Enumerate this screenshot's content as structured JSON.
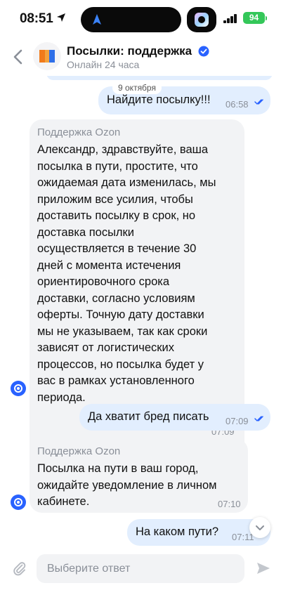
{
  "status_bar": {
    "time": "08:51",
    "battery": "94"
  },
  "header": {
    "title": "Посылки: поддержка",
    "subtitle": "Онлайн 24 часа"
  },
  "chat": {
    "date_separator": "9 октября",
    "messages": [
      {
        "direction": "out",
        "text": "Найдите посылку!!!",
        "time": "06:58",
        "read": true
      },
      {
        "direction": "in",
        "sender": "Поддержка Ozon",
        "lines": [
          "Александр, здравствуйте, ваша",
          "посылка в пути, простите, что",
          "ожидаемая дата изменилась, мы",
          "приложим все усилия, чтобы",
          "доставить посылку в срок, но",
          "доставка посылки",
          "осуществляется в течение 30",
          "дней с момента истечения",
          "ориентировочного срока",
          "доставки, согласно условиям",
          "оферты.  Точную дату доставки",
          "мы не указываем, так как сроки",
          "зависят от логистических",
          "процессов, но посылка будет у",
          "вас в рамках установленного",
          "периода."
        ],
        "time": "07:09"
      },
      {
        "direction": "out",
        "text": "Да хватит бред писать",
        "time": "07:09",
        "read": true
      },
      {
        "direction": "in",
        "sender": "Поддержка Ozon",
        "lines": [
          "Посылка на пути в ваш город,",
          "ожидайте уведомление в личном",
          "кабинете."
        ],
        "time": "07:10"
      },
      {
        "direction": "out",
        "text": "На каком пути?",
        "time": "07:11",
        "read": false
      }
    ]
  },
  "input": {
    "placeholder": "Выберите ответ"
  },
  "icons": {
    "back": "chevron-left-icon",
    "verified": "verified-badge-icon",
    "attach": "paperclip-icon",
    "send": "send-arrow-icon",
    "scroll_down": "chevron-down-icon"
  },
  "colors": {
    "outgoing_bubble": "#e2eefe",
    "incoming_bubble": "#f2f3f5",
    "accent": "#2962ff",
    "battery": "#34c759"
  }
}
